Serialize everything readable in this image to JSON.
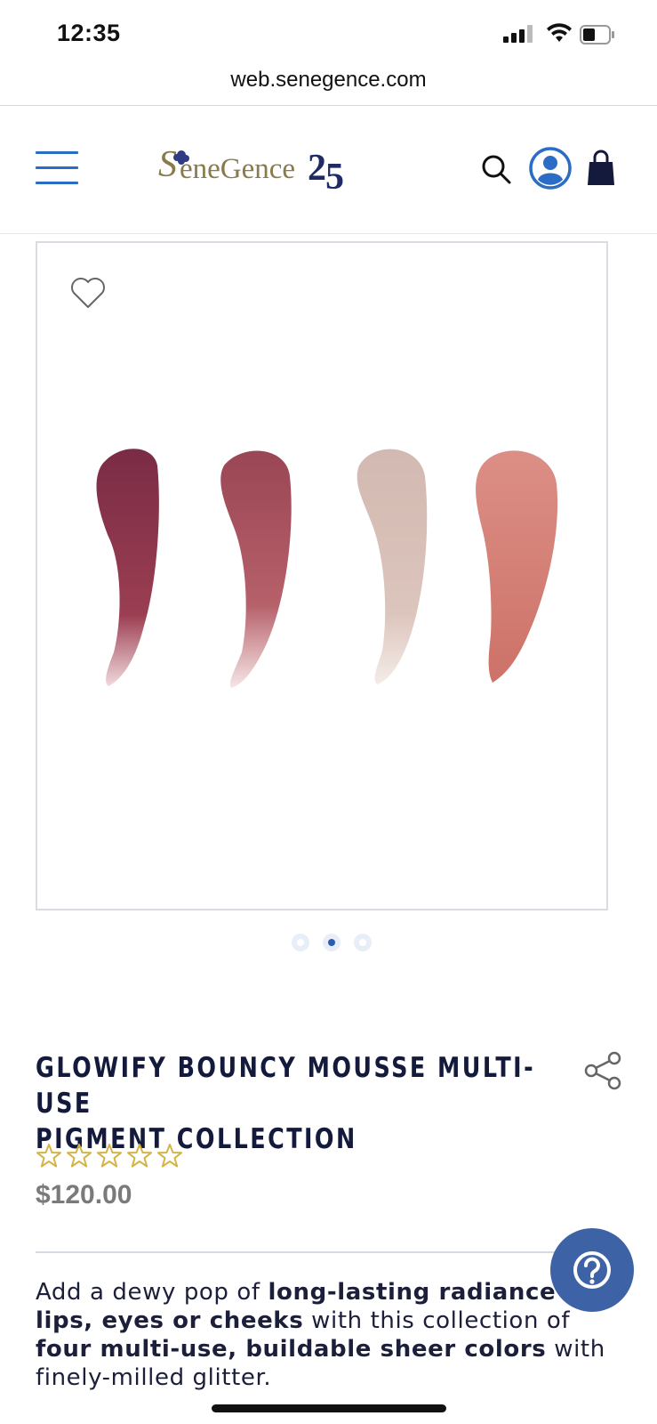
{
  "status_bar": {
    "time": "12:35"
  },
  "browser": {
    "url": "web.senegence.com"
  },
  "header": {
    "logo_text": "SeneGence",
    "logo_anniversary": "25"
  },
  "carousel": {
    "dot_count": 3,
    "active_index": 1
  },
  "swatch_colors": [
    "#8c3a4c",
    "#a7525b",
    "#d9c1b6",
    "#d7837a"
  ],
  "product": {
    "title_line1": "GLOWIFY BOUNCY MOUSSE MULTI-USE",
    "title_line2": "PIGMENT COLLECTION",
    "rating": 0,
    "rating_max": 5,
    "price": "$120.00"
  },
  "description": {
    "part1": "Add a dewy pop of ",
    "bold1": "long-lasting radiance",
    "part2": " to ",
    "bold2": "lips, eyes or cheeks",
    "part3": " with this collection of ",
    "bold3": "four multi-use, buildable sheer colors",
    "part4": " with finely-milled glitter."
  },
  "colors": {
    "accent_blue": "#2a6cc6",
    "navy": "#141a3c",
    "help_button": "#3d63a6",
    "star_gold": "#d4b446",
    "logo_gold": "#8a7a4a"
  }
}
